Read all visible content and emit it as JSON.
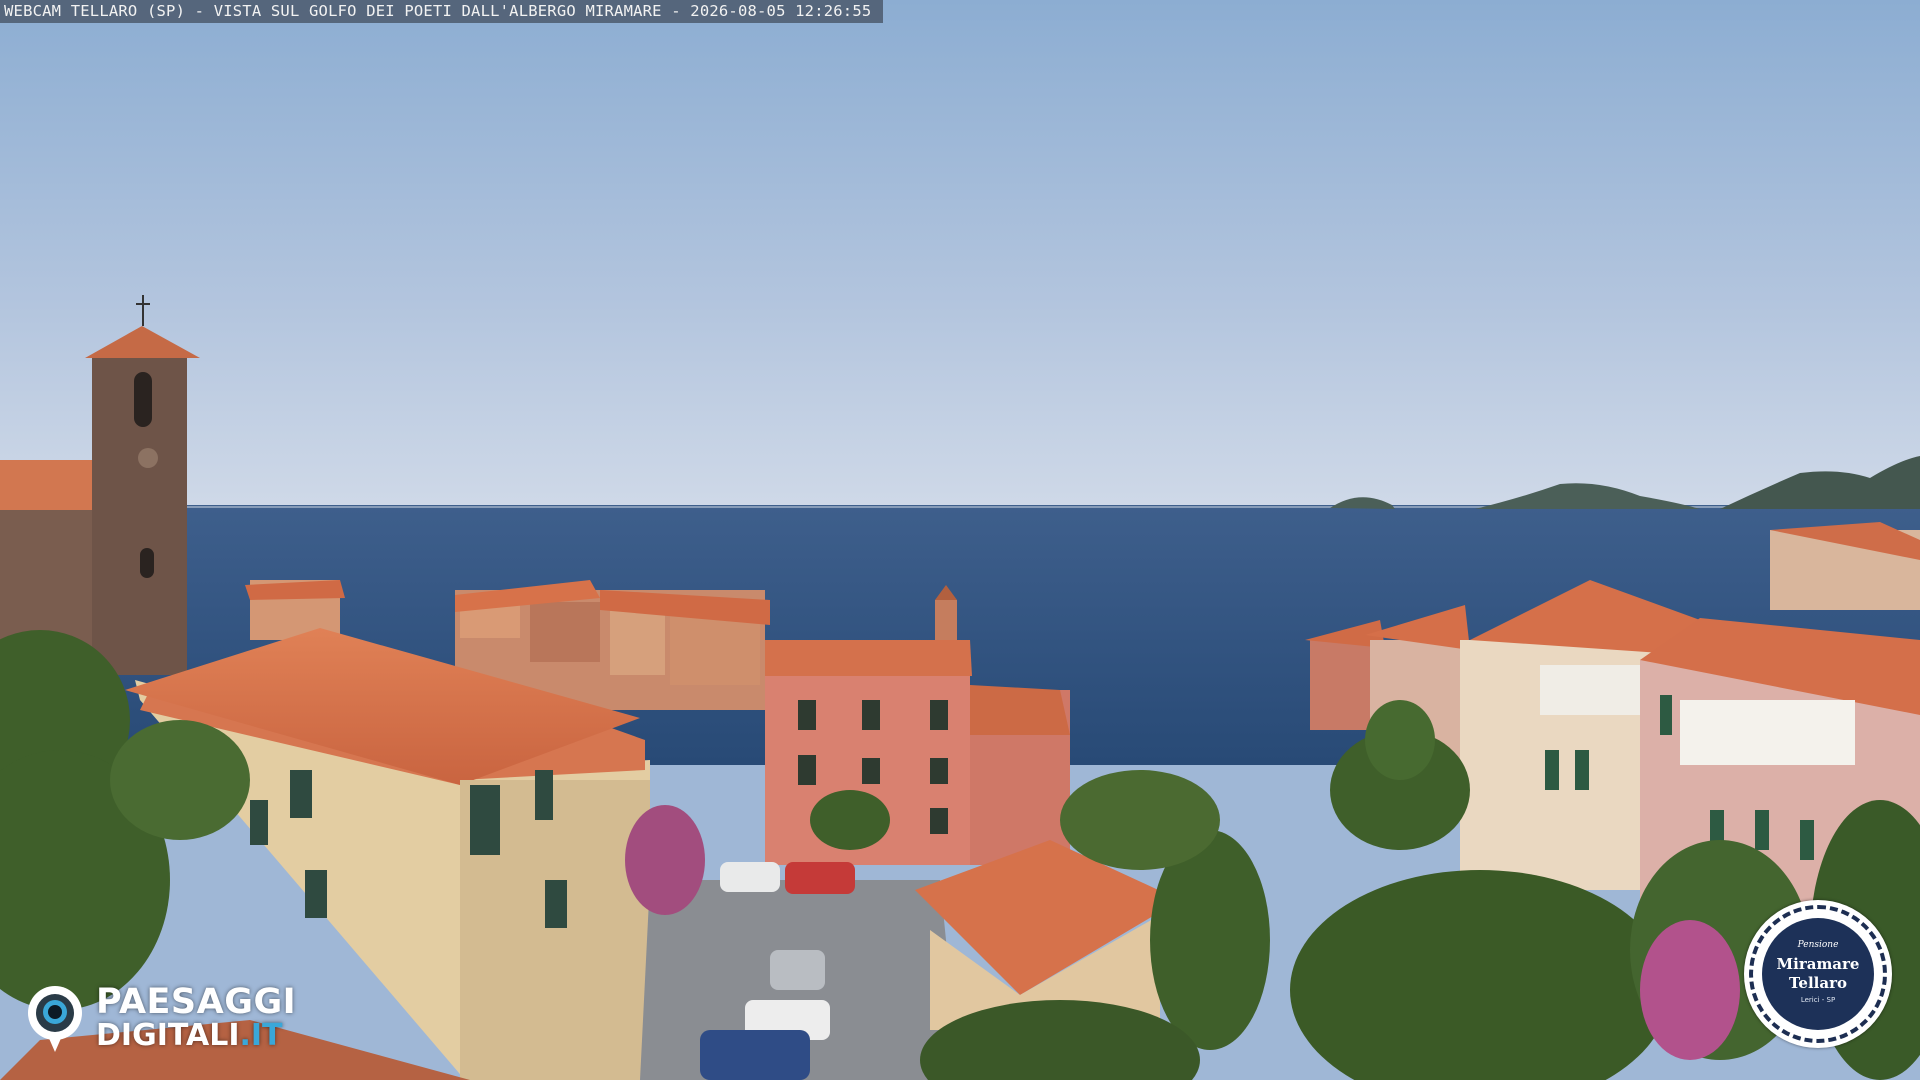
{
  "caption": "WEBCAM TELLARO (SP) - VISTA SUL GOLFO DEI POETI DALL'ALBERGO MIRAMARE - 2026-08-05 12:26:55",
  "logo_left": {
    "line1": "PAESAGGI",
    "line2": "DIGITALI",
    "line2_suffix": ".IT"
  },
  "badge": {
    "small_text": "Pensione",
    "line1": "Miramare",
    "line2": "Tellaro",
    "footer": "Lerici - SP"
  },
  "colors": {
    "sky_top": "#8eaed2",
    "sky_horizon": "#cbd6e6",
    "sea": "#2f4f7c",
    "roof": "#d9714c",
    "badge_blue": "#1d3158",
    "logo_cyan": "#3aa7d8"
  }
}
